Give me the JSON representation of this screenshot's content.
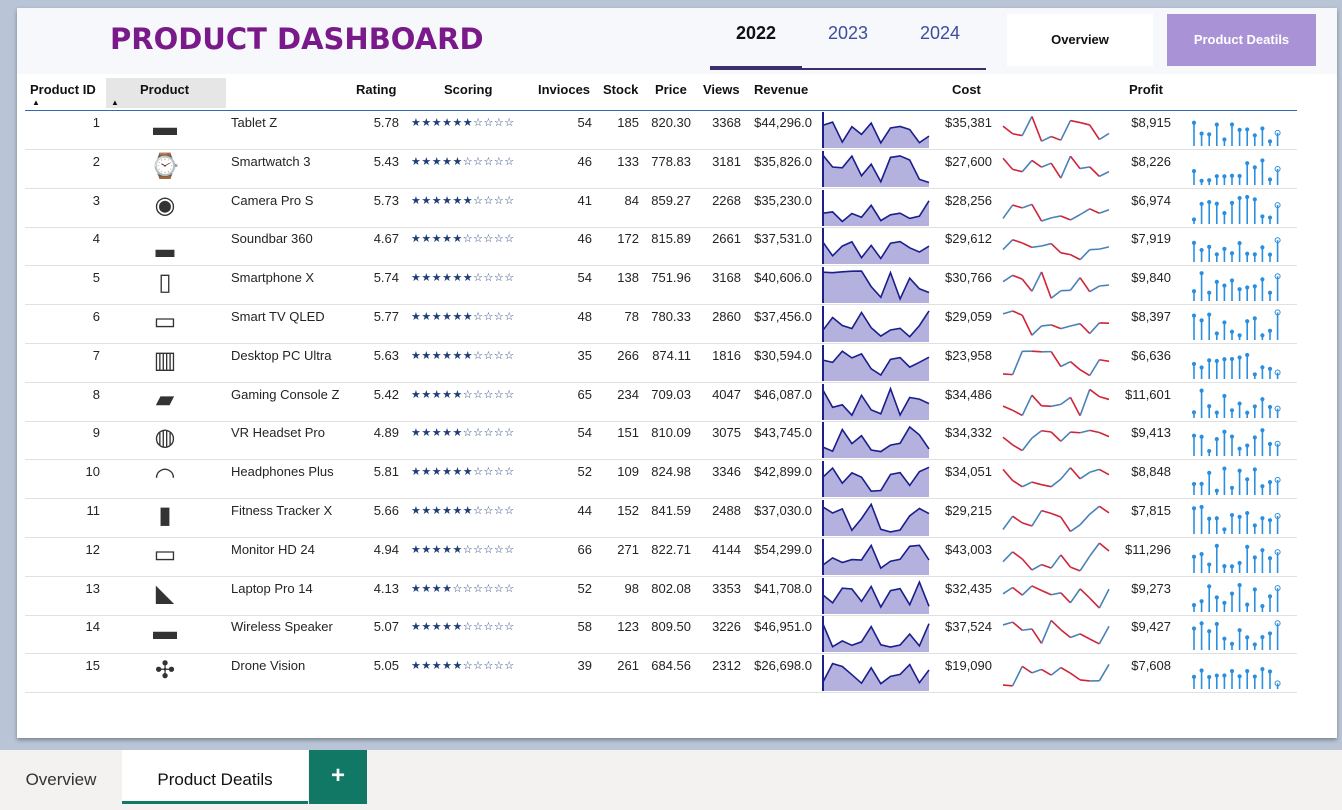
{
  "dashboard": {
    "title": "PRODUCT DASHBOARD",
    "years": [
      "2022",
      "2023",
      "2024"
    ],
    "active_year": "2022",
    "nav": {
      "overview": "Overview",
      "details": "Product Deatils"
    }
  },
  "table": {
    "headers": {
      "id": "Product ID",
      "product": "Product",
      "rating": "Rating",
      "scoring": "Scoring",
      "invoices": "Invioces",
      "stock": "Stock",
      "price": "Price",
      "views": "Views",
      "revenue": "Revenue",
      "cost": "Cost",
      "profit": "Profit"
    },
    "rows": [
      {
        "id": "1",
        "icon": "tablet-icon",
        "name": "Tablet Z",
        "rating": "5.78",
        "stars": 6,
        "invoices": "54",
        "stock": "185",
        "price": "820.30",
        "views": "3368",
        "revenue": "$44,296.0",
        "cost": "$35,381",
        "profit": "$8,915"
      },
      {
        "id": "2",
        "icon": "smartwatch-icon",
        "name": "Smartwatch 3",
        "rating": "5.43",
        "stars": 5,
        "invoices": "46",
        "stock": "133",
        "price": "778.83",
        "views": "3181",
        "revenue": "$35,826.0",
        "cost": "$27,600",
        "profit": "$8,226"
      },
      {
        "id": "3",
        "icon": "camera-icon",
        "name": "Camera Pro S",
        "rating": "5.73",
        "stars": 6,
        "invoices": "41",
        "stock": "84",
        "price": "859.27",
        "views": "2268",
        "revenue": "$35,230.0",
        "cost": "$28,256",
        "profit": "$6,974"
      },
      {
        "id": "4",
        "icon": "soundbar-icon",
        "name": "Soundbar 360",
        "rating": "4.67",
        "stars": 5,
        "invoices": "46",
        "stock": "172",
        "price": "815.89",
        "views": "2661",
        "revenue": "$37,531.0",
        "cost": "$29,612",
        "profit": "$7,919"
      },
      {
        "id": "5",
        "icon": "smartphone-icon",
        "name": "Smartphone X",
        "rating": "5.74",
        "stars": 6,
        "invoices": "54",
        "stock": "138",
        "price": "751.96",
        "views": "3168",
        "revenue": "$40,606.0",
        "cost": "$30,766",
        "profit": "$9,840"
      },
      {
        "id": "6",
        "icon": "tv-icon",
        "name": "Smart TV QLED",
        "rating": "5.77",
        "stars": 6,
        "invoices": "48",
        "stock": "78",
        "price": "780.33",
        "views": "2860",
        "revenue": "$37,456.0",
        "cost": "$29,059",
        "profit": "$8,397"
      },
      {
        "id": "7",
        "icon": "desktop-pc-icon",
        "name": "Desktop PC Ultra",
        "rating": "5.63",
        "stars": 6,
        "invoices": "35",
        "stock": "266",
        "price": "874.11",
        "views": "1816",
        "revenue": "$30,594.0",
        "cost": "$23,958",
        "profit": "$6,636"
      },
      {
        "id": "8",
        "icon": "game-console-icon",
        "name": "Gaming Console Z",
        "rating": "5.42",
        "stars": 5,
        "invoices": "65",
        "stock": "234",
        "price": "709.03",
        "views": "4047",
        "revenue": "$46,087.0",
        "cost": "$34,486",
        "profit": "$11,601"
      },
      {
        "id": "9",
        "icon": "vr-headset-icon",
        "name": "VR Headset Pro",
        "rating": "4.89",
        "stars": 5,
        "invoices": "54",
        "stock": "151",
        "price": "810.09",
        "views": "3075",
        "revenue": "$43,745.0",
        "cost": "$34,332",
        "profit": "$9,413"
      },
      {
        "id": "10",
        "icon": "headphones-icon",
        "name": "Headphones Plus",
        "rating": "5.81",
        "stars": 6,
        "invoices": "52",
        "stock": "109",
        "price": "824.98",
        "views": "3346",
        "revenue": "$42,899.0",
        "cost": "$34,051",
        "profit": "$8,848"
      },
      {
        "id": "11",
        "icon": "fitness-tracker-icon",
        "name": "Fitness Tracker X",
        "rating": "5.66",
        "stars": 6,
        "invoices": "44",
        "stock": "152",
        "price": "841.59",
        "views": "2488",
        "revenue": "$37,030.0",
        "cost": "$29,215",
        "profit": "$7,815"
      },
      {
        "id": "12",
        "icon": "monitor-icon",
        "name": "Monitor HD 24",
        "rating": "4.94",
        "stars": 5,
        "invoices": "66",
        "stock": "271",
        "price": "822.71",
        "views": "4144",
        "revenue": "$54,299.0",
        "cost": "$43,003",
        "profit": "$11,296"
      },
      {
        "id": "13",
        "icon": "laptop-icon",
        "name": "Laptop Pro 14",
        "rating": "4.13",
        "stars": 4,
        "invoices": "52",
        "stock": "98",
        "price": "802.08",
        "views": "3353",
        "revenue": "$41,708.0",
        "cost": "$32,435",
        "profit": "$9,273"
      },
      {
        "id": "14",
        "icon": "speaker-icon",
        "name": "Wireless Speaker",
        "rating": "5.07",
        "stars": 5,
        "invoices": "58",
        "stock": "123",
        "price": "809.50",
        "views": "3226",
        "revenue": "$46,951.0",
        "cost": "$37,524",
        "profit": "$9,427"
      },
      {
        "id": "15",
        "icon": "drone-icon",
        "name": "Drone Vision",
        "rating": "5.05",
        "stars": 5,
        "invoices": "39",
        "stock": "261",
        "price": "684.56",
        "views": "2312",
        "revenue": "$26,698.0",
        "cost": "$19,090",
        "profit": "$7,608"
      }
    ],
    "star_total": 10
  },
  "colors": {
    "title": "#7a1a8a",
    "area_fill": "#b4b1df",
    "area_line": "#1a1f8c",
    "line_up": "#4a82b8",
    "line_down": "#d1233a",
    "lollipop": "#2b8fe0",
    "accent": "#a993d6",
    "tab_green": "#117865"
  },
  "page_tabs": {
    "overview": "Overview",
    "details": "Product Deatils",
    "add": "+"
  }
}
